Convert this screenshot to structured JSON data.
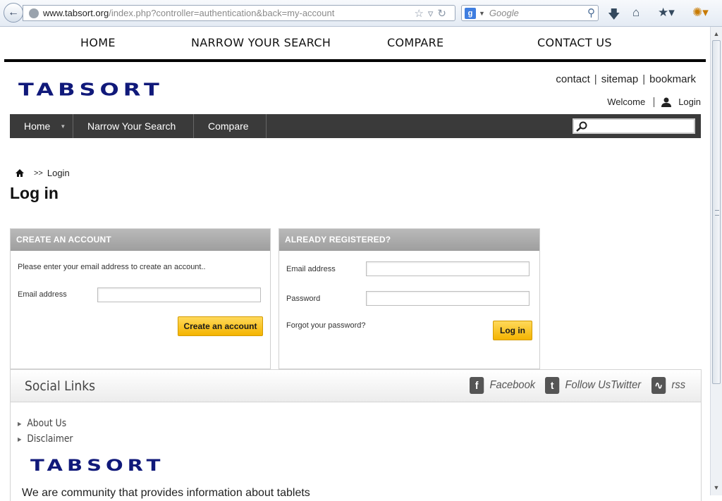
{
  "browser": {
    "url_domain": "www.tabsort.org",
    "url_rest": "/index.php?controller=authentication&back=my-account",
    "search_placeholder": "Google"
  },
  "topnav": [
    "HOME",
    "NARROW YOUR SEARCH",
    "COMPARE",
    "CONTACT US"
  ],
  "logo": "TABSORT",
  "header_links": [
    "contact",
    "sitemap",
    "bookmark"
  ],
  "welcome": "Welcome",
  "login_link": "Login",
  "menubar": {
    "items": [
      "Home",
      "Narrow Your Search",
      "Compare"
    ]
  },
  "breadcrumb": {
    "sep": ">>",
    "current": "Login"
  },
  "page_title": "Log in",
  "create_account": {
    "heading": "CREATE AN ACCOUNT",
    "intro": "Please enter your email address to create an account..",
    "email_label": "Email address",
    "email_value": "",
    "button": "Create an account"
  },
  "registered": {
    "heading": "ALREADY REGISTERED?",
    "email_label": "Email address",
    "email_value": "",
    "password_label": "Password",
    "password_value": "",
    "forgot": "Forgot your password?",
    "button": "Log in"
  },
  "social": {
    "title": "Social Links",
    "facebook": "Facebook",
    "twitter": "Follow UsTwitter",
    "rss": "rss"
  },
  "footer": {
    "links": [
      "About Us",
      "Disclaimer"
    ],
    "logo": "TABSORT",
    "text": "We are community that provides information about tablets"
  }
}
